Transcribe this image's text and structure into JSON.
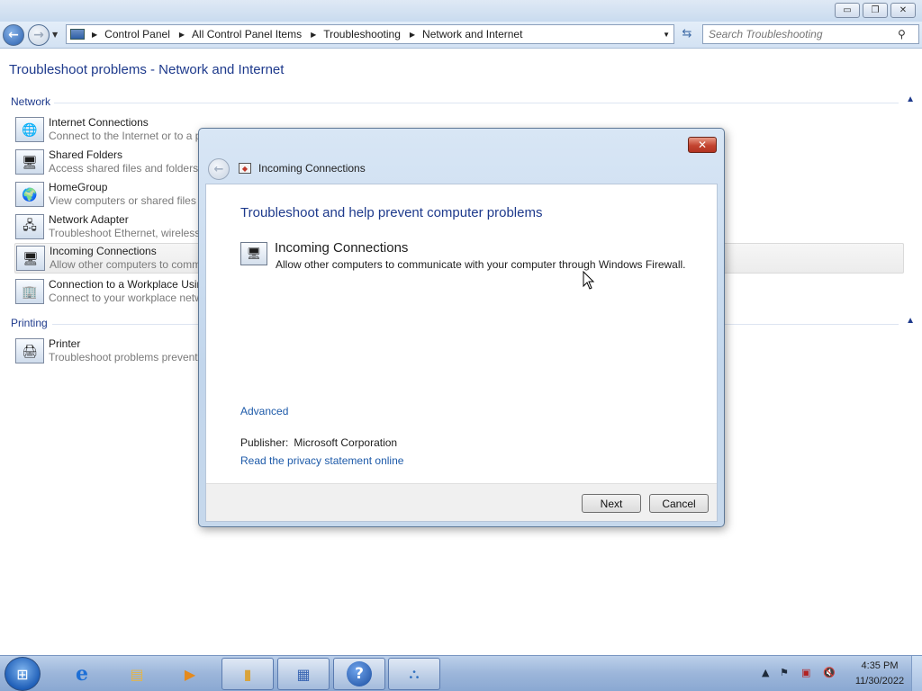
{
  "window": {
    "caption_buttons": {
      "minimize": "▭",
      "maximize": "❐",
      "close": "✕"
    }
  },
  "navbar": {
    "breadcrumbs": [
      "Control Panel",
      "All Control Panel Items",
      "Troubleshooting",
      "Network and Internet"
    ],
    "search_placeholder": "Search Troubleshooting"
  },
  "content": {
    "page_title": "Troubleshoot problems - Network and Internet",
    "sections": {
      "network": {
        "label": "Network",
        "items": [
          {
            "title": "Internet Connections",
            "desc": "Connect to the Internet or to a p",
            "icon": "globe-icon"
          },
          {
            "title": "Shared Folders",
            "desc": "Access shared files and folders o",
            "icon": "shared-folder-icon"
          },
          {
            "title": "HomeGroup",
            "desc": "View computers or shared files i",
            "icon": "homegroup-icon"
          },
          {
            "title": "Network Adapter",
            "desc": "Troubleshoot Ethernet, wireless,",
            "icon": "network-adapter-icon"
          },
          {
            "title": "Incoming Connections",
            "desc": "Allow other computers to comm",
            "icon": "incoming-connections-icon"
          },
          {
            "title": "Connection to a Workplace Usin",
            "desc": "Connect to your workplace netw",
            "icon": "workplace-icon"
          }
        ]
      },
      "printing": {
        "label": "Printing",
        "items": [
          {
            "title": "Printer",
            "desc": "Troubleshoot problems prevent",
            "icon": "printer-icon"
          }
        ]
      }
    }
  },
  "dialog": {
    "title": "Incoming Connections",
    "close_glyph": "✕",
    "heading": "Troubleshoot and help prevent computer problems",
    "option_title": "Incoming Connections",
    "option_desc": "Allow other computers to communicate with your computer through Windows Firewall.",
    "advanced_link": "Advanced",
    "publisher_label": "Publisher:",
    "publisher_value": "Microsoft Corporation",
    "privacy_link": "Read the privacy statement online",
    "next_label": "Next",
    "cancel_label": "Cancel"
  },
  "taskbar": {
    "clock_time": "4:35 PM",
    "clock_date": "11/30/2022"
  }
}
